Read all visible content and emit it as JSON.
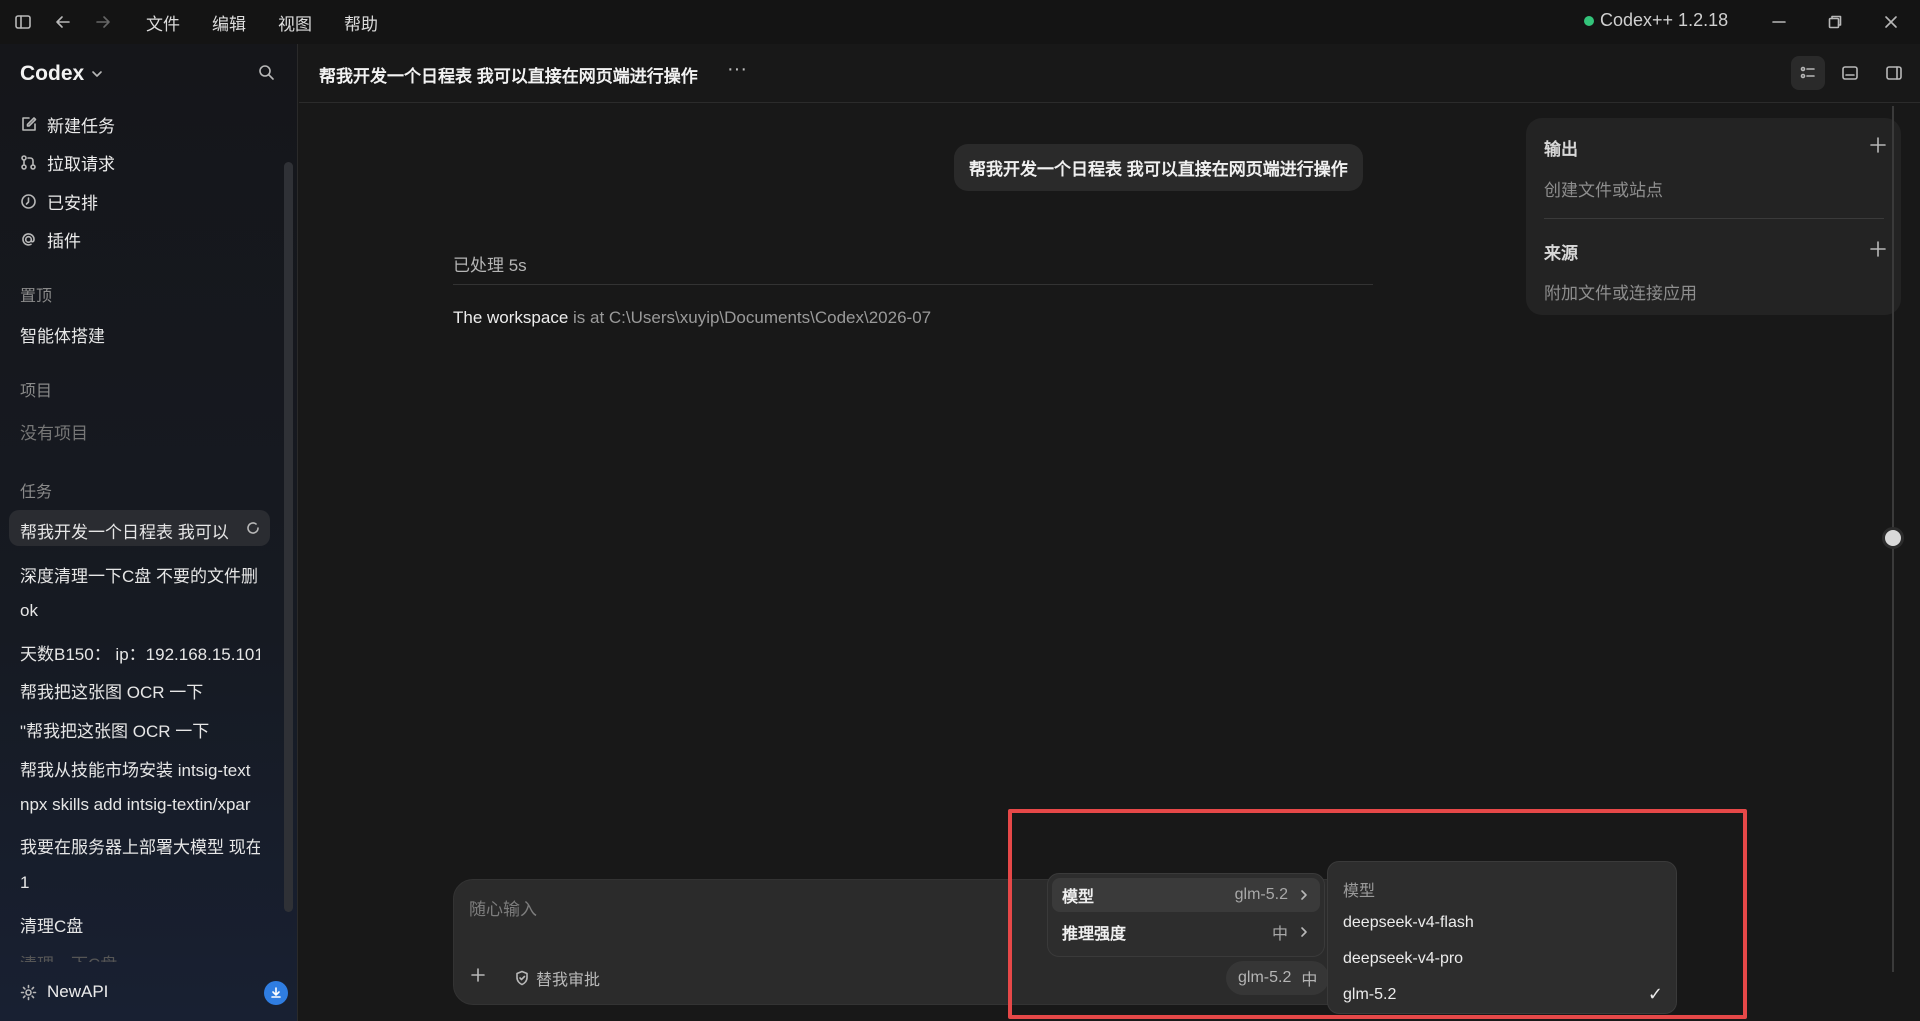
{
  "titlebar": {
    "menu": [
      "文件",
      "编辑",
      "视图",
      "帮助"
    ],
    "app_version": "Codex++ 1.2.18",
    "status_color": "#33c47a"
  },
  "sidebar": {
    "brand": "Codex",
    "nav": [
      {
        "label": "新建任务",
        "icon": "edit-icon"
      },
      {
        "label": "拉取请求",
        "icon": "pull-request-icon"
      },
      {
        "label": "已安排",
        "icon": "clock-icon"
      },
      {
        "label": "插件",
        "icon": "at-icon"
      }
    ],
    "pinned_label": "置顶",
    "pinned_items": [
      "智能体搭建"
    ],
    "projects_label": "项目",
    "projects_empty": "没有项目",
    "tasks_label": "任务",
    "tasks": [
      "帮我开发一个日程表 我可以",
      "深度清理一下C盘 不要的文件删",
      "ok",
      "天数B150： ip：192.168.15.101",
      "帮我把这张图 OCR 一下",
      "\"帮我把这张图 OCR 一下",
      "帮我从技能市场安装 intsig-text",
      "npx skills add intsig-textin/xpar",
      "我要在服务器上部署大模型 现在",
      "1",
      "清理C盘",
      "清理一下C盘"
    ],
    "footer_label": "NewAPI",
    "accent": "#2f7de1"
  },
  "header": {
    "title": "帮我开发一个日程表 我可以直接在网页端进行操作",
    "more": "···"
  },
  "chat": {
    "user_message": "帮我开发一个日程表 我可以直接在网页端进行操作",
    "processed": "已处理 5s",
    "assistant_a": "The workspace",
    "assistant_b": " is at C:\\Users\\xuyip\\Documents\\Codex\\2026-07"
  },
  "right_panel": {
    "output_title": "输出",
    "output_sub": "创建文件或站点",
    "source_title": "来源",
    "source_sub": "附加文件或连接应用"
  },
  "composer": {
    "placeholder": "随心输入",
    "approval_label": "替我审批",
    "model_chip": "glm-5.2",
    "effort_chip": "中"
  },
  "model_menu": {
    "rows": [
      {
        "label": "模型",
        "value": "glm-5.2"
      },
      {
        "label": "推理强度",
        "value": "中"
      }
    ]
  },
  "model_submenu": {
    "header": "模型",
    "options": [
      "deepseek-v4-flash",
      "deepseek-v4-pro",
      "glm-5.2"
    ],
    "selected": "glm-5.2",
    "check": "✓"
  },
  "highlight_color": "#e64848"
}
